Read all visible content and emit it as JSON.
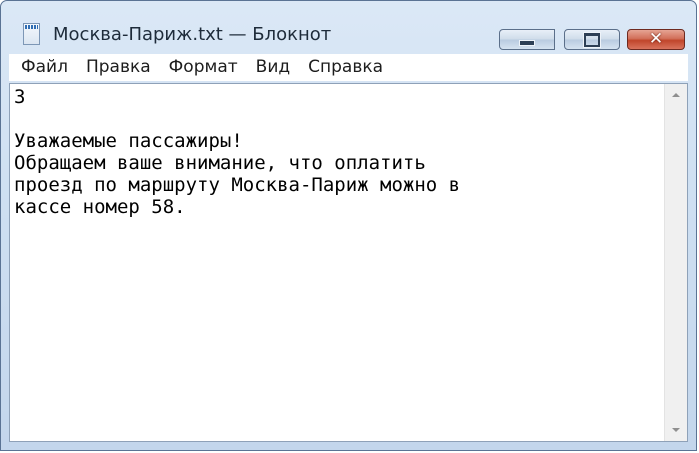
{
  "window": {
    "title": "Москва-Париж.txt — Блокнот",
    "app_icon": "notepad-icon",
    "controls": {
      "minimize": "minimize-icon",
      "maximize": "maximize-icon",
      "close": "close-icon",
      "close_glyph": "✕"
    },
    "colors": {
      "close_button": "#c7472d",
      "frame": "#cfe0f2"
    }
  },
  "menubar": {
    "items": [
      "Файл",
      "Правка",
      "Формат",
      "Вид",
      "Справка"
    ]
  },
  "editor": {
    "content": "3\n\nУважаемые пассажиры!\nОбращаем ваше внимание, что оплатить\nпроезд по маршруту Москва-Париж можно в\nкассе номер 58."
  }
}
